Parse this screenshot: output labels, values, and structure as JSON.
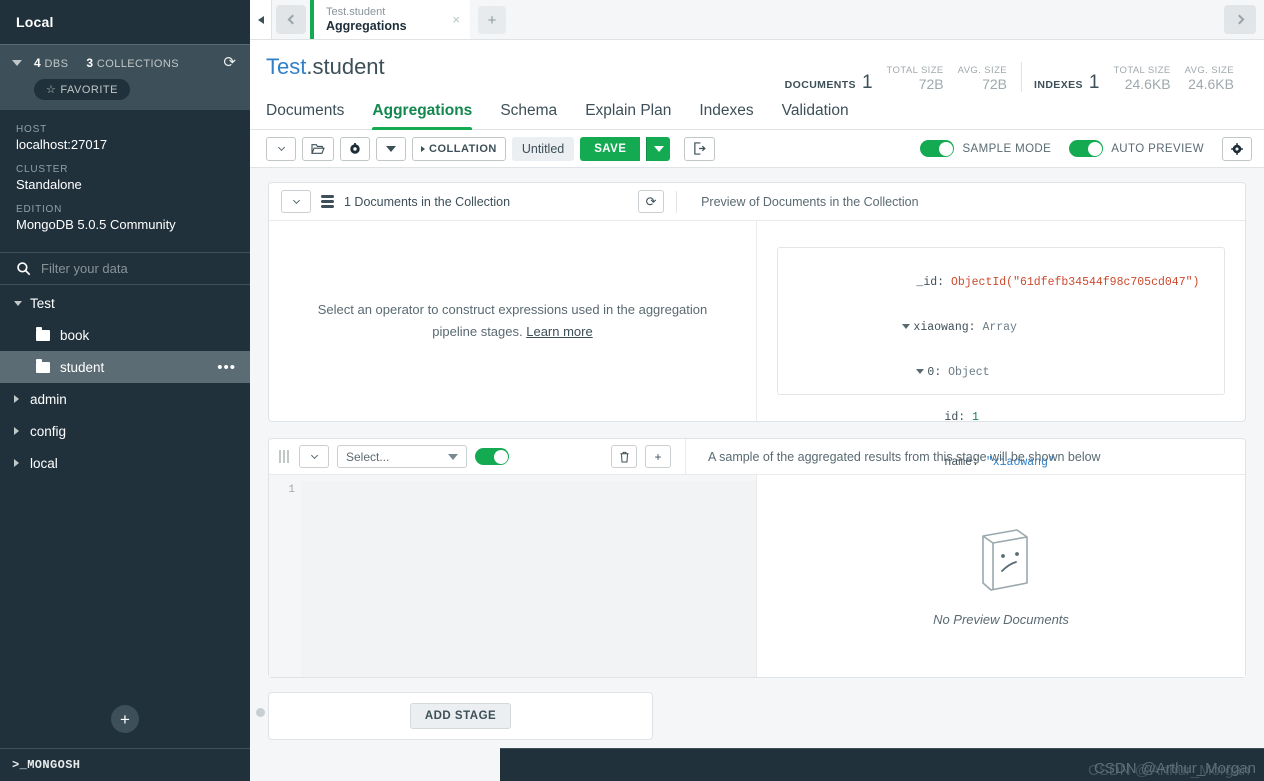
{
  "sidebar": {
    "title": "Local",
    "stats": {
      "dbs_count": "4",
      "dbs_label": "DBS",
      "collections_count": "3",
      "collections_label": "COLLECTIONS"
    },
    "favorite_label": "FAVORITE",
    "meta": [
      {
        "label": "HOST",
        "value": "localhost:27017"
      },
      {
        "label": "CLUSTER",
        "value": "Standalone"
      },
      {
        "label": "EDITION",
        "value": "MongoDB 5.0.5 Community"
      }
    ],
    "filter_placeholder": "Filter your data",
    "filter_value": "",
    "tree": [
      {
        "name": "Test",
        "type": "db",
        "expanded": true
      },
      {
        "name": "book",
        "type": "collection",
        "selected": false
      },
      {
        "name": "student",
        "type": "collection",
        "selected": true,
        "menu": "•••"
      },
      {
        "name": "admin",
        "type": "db",
        "expanded": false
      },
      {
        "name": "config",
        "type": "db",
        "expanded": false
      },
      {
        "name": "local",
        "type": "db",
        "expanded": false
      }
    ],
    "add_label": "+",
    "shell_label": ">_MONGOSH"
  },
  "tabbar": {
    "tab": {
      "subtitle": "Test.student",
      "title": "Aggregations",
      "close": "×"
    },
    "new_tab": "+"
  },
  "collection": {
    "db_name": "Test",
    "separator": ".",
    "coll_name": "student",
    "stats": {
      "documents_label": "DOCUMENTS",
      "documents_value": "1",
      "documents_total_size_label": "TOTAL SIZE",
      "documents_total_size": "72B",
      "documents_avg_size_label": "AVG. SIZE",
      "documents_avg_size": "72B",
      "indexes_label": "INDEXES",
      "indexes_value": "1",
      "indexes_total_size_label": "TOTAL SIZE",
      "indexes_total_size": "24.6KB",
      "indexes_avg_size_label": "AVG. SIZE",
      "indexes_avg_size": "24.6KB"
    }
  },
  "nav_tabs": [
    {
      "label": "Documents",
      "active": false
    },
    {
      "label": "Aggregations",
      "active": true
    },
    {
      "label": "Schema",
      "active": false
    },
    {
      "label": "Explain Plan",
      "active": false
    },
    {
      "label": "Indexes",
      "active": false
    },
    {
      "label": "Validation",
      "active": false
    }
  ],
  "toolbar": {
    "collation_label": "COLLATION",
    "pipeline_name": "Untitled",
    "save_label": "SAVE",
    "sample_mode_label": "SAMPLE MODE",
    "sample_mode_on": true,
    "auto_preview_label": "AUTO PREVIEW",
    "auto_preview_on": true,
    "settings_icon": "⚙"
  },
  "input_panel": {
    "documents_count_text": "1 Documents in the Collection",
    "refresh_icon": "⟳",
    "preview_label": "Preview of Documents in the Collection",
    "hint_text": "Select an operator to construct expressions used in the aggregation pipeline stages.",
    "hint_link": "Learn more",
    "document": {
      "id_key": "_id",
      "id_value": "ObjectId(\"61dfefb34544f98c705cd047\")",
      "array_key": "xiaowang",
      "array_type": "Array",
      "object_index": "0",
      "object_type": "Object",
      "fields": [
        {
          "key": "id",
          "value": "1",
          "kind": "number"
        },
        {
          "key": "name",
          "value": "\"xiaowang\"",
          "kind": "string"
        }
      ]
    }
  },
  "stage": {
    "operator_placeholder": "Select...",
    "enabled": true,
    "delete_icon": "🗑",
    "add_icon": "+",
    "note": "A sample of the aggregated results from this stage will be shown below",
    "line_number": "1",
    "code": "",
    "no_preview_text": "No Preview Documents"
  },
  "add_stage": {
    "label": "ADD STAGE"
  },
  "watermark": {
    "text": "CSDN @Arthur_Morgan",
    "text2": "CSDN @Arthur_Morgan"
  },
  "colors": {
    "brand_green": "#13aa52",
    "sidebar_bg": "#21313c",
    "link_blue": "#2f80c8"
  }
}
